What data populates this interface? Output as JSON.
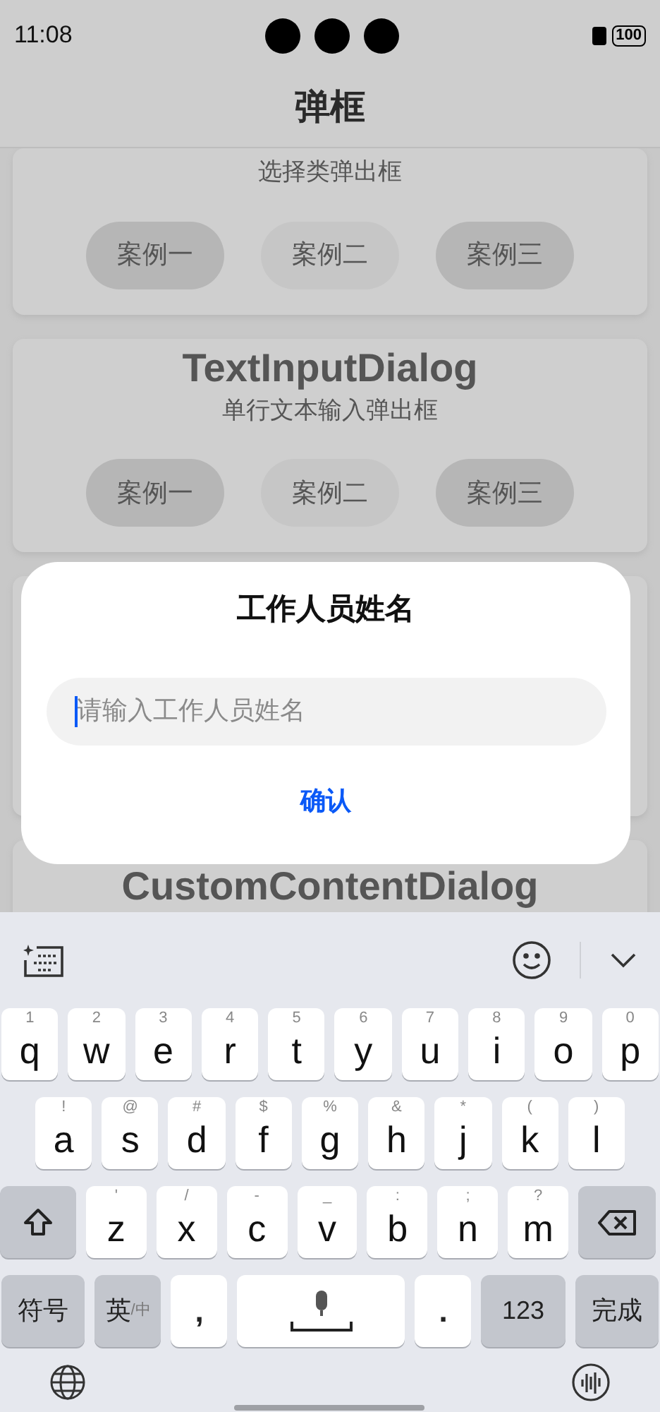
{
  "status_bar": {
    "time": "11:08",
    "battery": "100"
  },
  "header": {
    "title": "弹框"
  },
  "cards": [
    {
      "subtitle": "选择类弹出框",
      "buttons": [
        {
          "label": "案例一",
          "pressed": false
        },
        {
          "label": "案例二",
          "pressed": true
        },
        {
          "label": "案例三",
          "pressed": false
        }
      ]
    },
    {
      "title": "TextInputDialog",
      "subtitle": "单行文本输入弹出框",
      "buttons": [
        {
          "label": "案例一",
          "pressed": false
        },
        {
          "label": "案例二",
          "pressed": true
        },
        {
          "label": "案例三",
          "pressed": false
        }
      ]
    },
    {
      "title": "CustomContentDialog"
    }
  ],
  "dialog": {
    "title": "工作人员姓名",
    "input": {
      "placeholder": "请输入工作人员姓名"
    },
    "confirm": "确认"
  },
  "keyboard": {
    "rows": [
      {
        "keys": [
          {
            "kind": "char",
            "label": "q",
            "hint": "1"
          },
          {
            "kind": "char",
            "label": "w",
            "hint": "2"
          },
          {
            "kind": "char",
            "label": "e",
            "hint": "3"
          },
          {
            "kind": "char",
            "label": "r",
            "hint": "4"
          },
          {
            "kind": "char",
            "label": "t",
            "hint": "5"
          },
          {
            "kind": "char",
            "label": "y",
            "hint": "6"
          },
          {
            "kind": "char",
            "label": "u",
            "hint": "7"
          },
          {
            "kind": "char",
            "label": "i",
            "hint": "8"
          },
          {
            "kind": "char",
            "label": "o",
            "hint": "9"
          },
          {
            "kind": "char",
            "label": "p",
            "hint": "0"
          }
        ]
      },
      {
        "keys": [
          {
            "kind": "char",
            "label": "a",
            "hint": "!"
          },
          {
            "kind": "char",
            "label": "s",
            "hint": "@"
          },
          {
            "kind": "char",
            "label": "d",
            "hint": "#"
          },
          {
            "kind": "char",
            "label": "f",
            "hint": "$"
          },
          {
            "kind": "char",
            "label": "g",
            "hint": "%"
          },
          {
            "kind": "char",
            "label": "h",
            "hint": "&"
          },
          {
            "kind": "char",
            "label": "j",
            "hint": "*"
          },
          {
            "kind": "char",
            "label": "k",
            "hint": "("
          },
          {
            "kind": "char",
            "label": "l",
            "hint": ")"
          }
        ]
      },
      {
        "keys": [
          {
            "kind": "shift"
          },
          {
            "kind": "char",
            "label": "z",
            "hint": "'"
          },
          {
            "kind": "char",
            "label": "x",
            "hint": "/"
          },
          {
            "kind": "char",
            "label": "c",
            "hint": "-"
          },
          {
            "kind": "char",
            "label": "v",
            "hint": "_"
          },
          {
            "kind": "char",
            "label": "b",
            "hint": ":"
          },
          {
            "kind": "char",
            "label": "n",
            "hint": ";"
          },
          {
            "kind": "char",
            "label": "m",
            "hint": "?"
          },
          {
            "kind": "backspace"
          }
        ]
      },
      {
        "keys": [
          {
            "kind": "func",
            "label": "符号"
          },
          {
            "kind": "lang",
            "label": "英",
            "sub": "/中"
          },
          {
            "kind": "punct",
            "label": ","
          },
          {
            "kind": "space"
          },
          {
            "kind": "punct",
            "label": "."
          },
          {
            "kind": "func",
            "label": "123"
          },
          {
            "kind": "func",
            "label": "完成"
          }
        ]
      }
    ]
  }
}
